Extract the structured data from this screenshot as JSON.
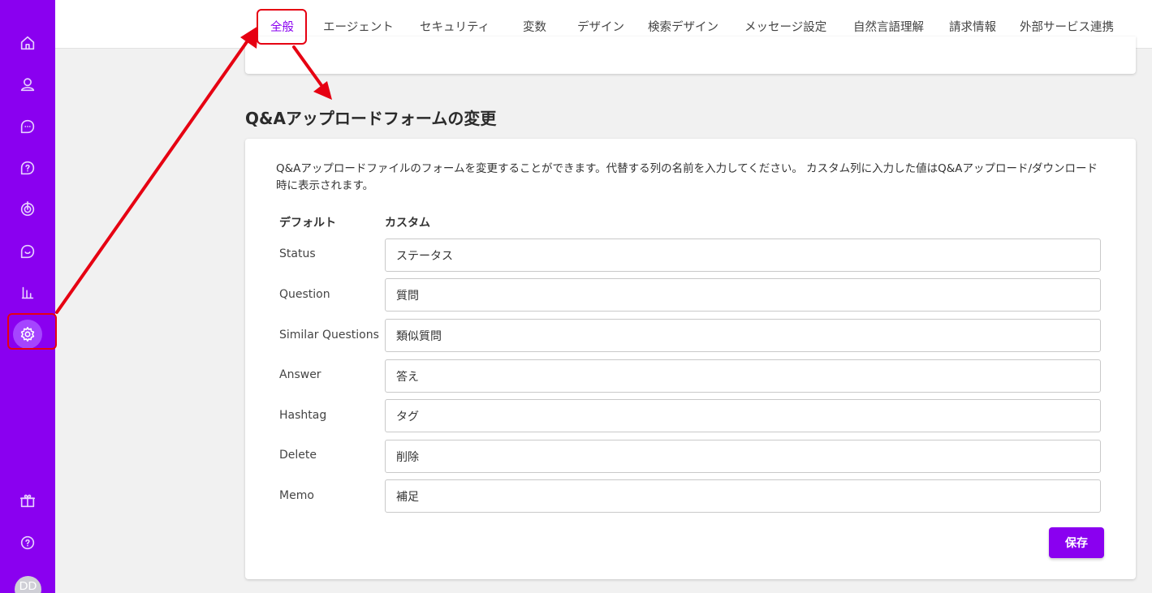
{
  "sidebar": {
    "items": [
      {
        "name": "home-icon"
      },
      {
        "name": "user-icon"
      },
      {
        "name": "chat-bubble-icon"
      },
      {
        "name": "question-icon"
      },
      {
        "name": "target-icon"
      },
      {
        "name": "message-icon"
      },
      {
        "name": "bar-chart-icon"
      },
      {
        "name": "gear-icon",
        "active": true
      },
      {
        "name": "gift-icon"
      },
      {
        "name": "help-icon"
      }
    ],
    "avatar_initials": "DD"
  },
  "tabs": [
    {
      "label": "全般",
      "active": true
    },
    {
      "label": "エージェント"
    },
    {
      "label": "セキュリティ"
    },
    {
      "label": "変数"
    },
    {
      "label": "デザイン"
    },
    {
      "label": "検索デザイン"
    },
    {
      "label": "メッセージ設定"
    },
    {
      "label": "自然言語理解"
    },
    {
      "label": "請求情報"
    },
    {
      "label": "外部サービス連携"
    }
  ],
  "section": {
    "title": "Q&Aアップロードフォームの変更",
    "description": "Q&Aアップロードファイルのフォームを変更することができます。代替する列の名前を入力してください。 カスタム列に入力した値はQ&Aアップロード/ダウンロード時に表示されます。",
    "col_default": "デフォルト",
    "col_custom": "カスタム",
    "rows": [
      {
        "label": "Status",
        "value": "ステータス"
      },
      {
        "label": "Question",
        "value": "質問"
      },
      {
        "label": "Similar Questions",
        "value": "類似質問"
      },
      {
        "label": "Answer",
        "value": "答え"
      },
      {
        "label": "Hashtag",
        "value": "タグ"
      },
      {
        "label": "Delete",
        "value": "削除"
      },
      {
        "label": "Memo",
        "value": "補足"
      }
    ],
    "save_label": "保存"
  },
  "colors": {
    "accent": "#8a00f0",
    "annotation": "#e60012"
  }
}
